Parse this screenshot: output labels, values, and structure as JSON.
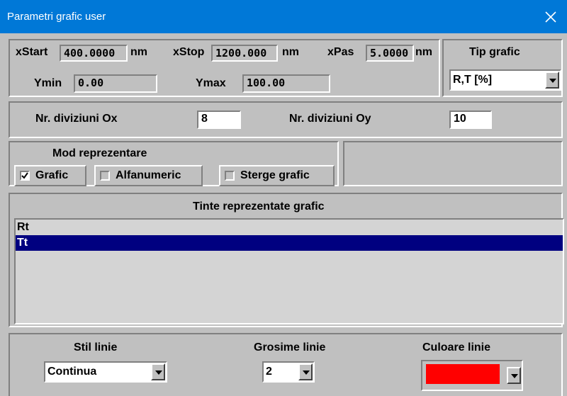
{
  "window": {
    "title": "Parametri grafic user"
  },
  "icons": {
    "close": "close-icon",
    "dropdown": "dropdown-arrow-icon",
    "check": "check-icon"
  },
  "range": {
    "xstart_label": "xStart",
    "xstart_value": "400.0000",
    "xstart_unit": "nm",
    "xstop_label": "xStop",
    "xstop_value": "1200.000",
    "xstop_unit": "nm",
    "xpas_label": "xPas",
    "xpas_value": "5.0000",
    "xpas_unit": "nm",
    "ymin_label": "Ymin",
    "ymin_value": "0.00",
    "ymax_label": "Ymax",
    "ymax_value": "100.00"
  },
  "tip_grafic": {
    "label": "Tip grafic",
    "value": "R,T [%]"
  },
  "divisions": {
    "ox_label": "Nr. diviziuni Ox",
    "ox_value": "8",
    "oy_label": "Nr. diviziuni Oy",
    "oy_value": "10"
  },
  "mode": {
    "label": "Mod reprezentare",
    "options": [
      {
        "label": "Grafic",
        "checked": true
      },
      {
        "label": "Alfanumeric",
        "checked": false
      },
      {
        "label": "Sterge grafic",
        "checked": false
      }
    ]
  },
  "targets": {
    "header": "Tinte reprezentate grafic",
    "items": [
      {
        "label": "Rt",
        "selected": false
      },
      {
        "label": "Tt",
        "selected": true
      }
    ]
  },
  "line": {
    "style_label": "Stil linie",
    "style_value": "Continua",
    "width_label": "Grosime linie",
    "width_value": "2",
    "color_label": "Culoare linie",
    "color_value": "#ff0000"
  },
  "colors": {
    "titlebar": "#0078d7",
    "face": "#c0c0c0",
    "selection": "#000080"
  }
}
